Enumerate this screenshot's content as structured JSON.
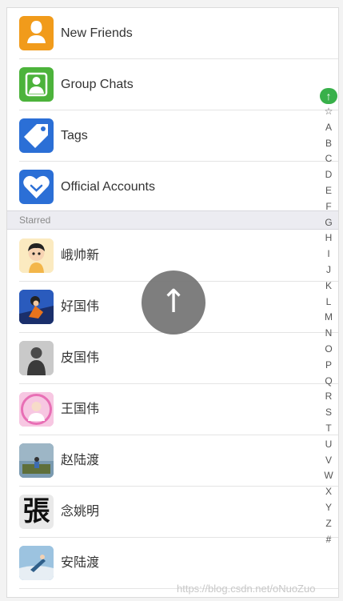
{
  "fixed_items": [
    {
      "label": "New Friends",
      "icon": "new-friend-icon",
      "color": "#f19b1b"
    },
    {
      "label": "Group Chats",
      "icon": "group-chat-icon",
      "color": "#4cb33b"
    },
    {
      "label": "Tags",
      "icon": "tag-icon",
      "color": "#2b6fd6"
    },
    {
      "label": "Official Accounts",
      "icon": "official-account-icon",
      "color": "#2b6fd6"
    }
  ],
  "section": {
    "starred_label": "Starred"
  },
  "contacts": [
    {
      "name": "峨帅新"
    },
    {
      "name": "好国伟"
    },
    {
      "name": "皮国伟"
    },
    {
      "name": "王国伟"
    },
    {
      "name": "赵陆渡"
    },
    {
      "name": "念姚明",
      "avatar_char": "張"
    },
    {
      "name": "安陆渡"
    }
  ],
  "index_bar": {
    "top_symbol": "↑",
    "letters": [
      "☆",
      "A",
      "B",
      "C",
      "D",
      "E",
      "F",
      "G",
      "H",
      "I",
      "J",
      "K",
      "L",
      "M",
      "N",
      "O",
      "P",
      "Q",
      "R",
      "S",
      "T",
      "U",
      "V",
      "W",
      "X",
      "Y",
      "Z",
      "#"
    ]
  },
  "float_button": {
    "symbol": "↑"
  },
  "watermark": "https://blog.csdn.net/oNuoZuo"
}
